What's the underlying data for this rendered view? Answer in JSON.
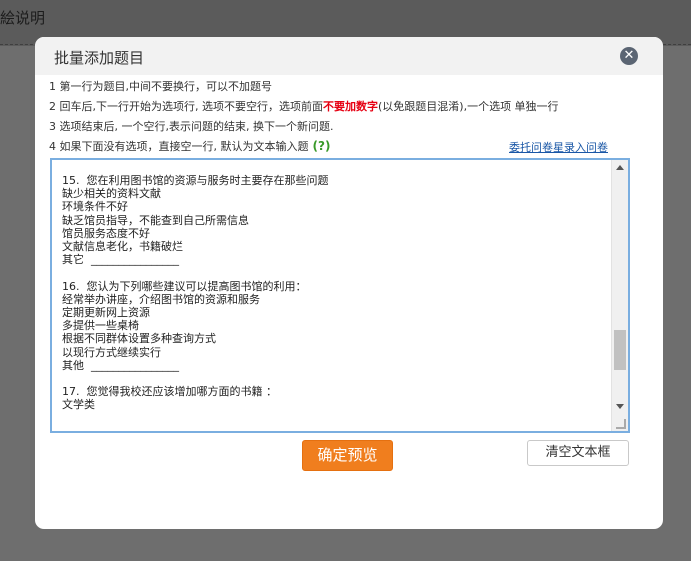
{
  "background": {
    "title": "絵说明"
  },
  "modal": {
    "title": "批量添加题目",
    "close_icon": "close-icon",
    "instructions": {
      "line1": "1 第一行为题目,中间不要换行，可以不加题号",
      "line2_part1": "2 回车后,下一行开始为选项行, 选项不要空行，选项前面",
      "line2_highlight": "不要加数字",
      "line2_part2": "(以免跟题目混淆),一个选项 单独一行",
      "line3": "3 选项结束后, 一个空行,表示问题的结束, 换下一个新问题.",
      "line4": "4 如果下面没有选项，直接空一行, 默认为文本输入题",
      "help": "(?)"
    },
    "link_text": "委托问卷星录入问卷",
    "textarea_content": "15.  您在利用图书馆的资源与服务时主要存在那些问题\n缺少相关的资料文献\n环境条件不好\n缺乏馆员指导，不能查到自己所需信息\n馆员服务态度不好\n文献信息老化，书籍破烂\n其它  ________________\n\n16.  您认为下列哪些建议可以提高图书馆的利用：\n经常举办讲座，介绍图书馆的资源和服务\n定期更新网上资源\n多提供一些桌椅\n根据不同群体设置多种查询方式\n以现行方式继续实行\n其他  ________________\n\n17.  您觉得我校还应该增加哪方面的书籍 ：\n文学类",
    "buttons": {
      "preview": "确定预览",
      "clear": "清空文本框"
    },
    "colors": {
      "accent": "#f07e1e",
      "link": "#1a57a6",
      "warning": "#e60012",
      "help": "#3a9a2a"
    }
  }
}
